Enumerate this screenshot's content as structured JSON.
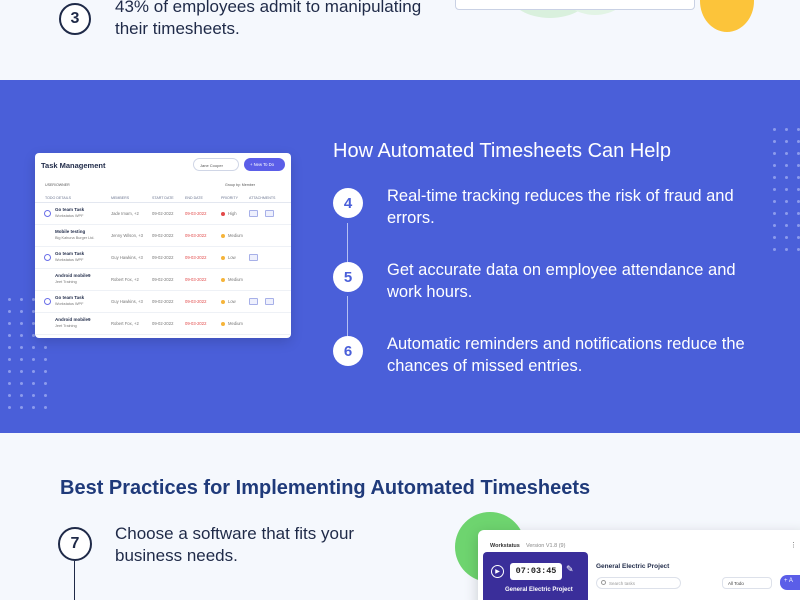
{
  "top": {
    "step_number": "3",
    "text": "43% of employees admit to manipulating their timesheets."
  },
  "blue": {
    "title": "How Automated Timesheets Can Help",
    "steps": [
      {
        "number": "4",
        "text": "Real-time tracking reduces the risk of fraud and errors."
      },
      {
        "number": "5",
        "text": "Get accurate data on employee attendance and work hours."
      },
      {
        "number": "6",
        "text": "Automatic reminders and notifications reduce the chances of missed entries."
      }
    ]
  },
  "task_card": {
    "title": "Task Management",
    "user_select": "Jane Cooper",
    "new_button": "+ New To Do",
    "subheading": "USER/OWNER",
    "group_by": "Group by: Member",
    "columns": [
      "TODO DETAILS",
      "MEMBERS",
      "START DATE",
      "END DATE",
      "PRIORITY",
      "ATTACHMENTS"
    ],
    "rows": [
      {
        "name": "Go team Task",
        "project": "Workstatus WPF",
        "members": "Jade Imam, +2",
        "start": "09-02-2022",
        "end": "09-03-2022",
        "priority": "High",
        "priority_color": "#e24a4a"
      },
      {
        "name": "Mobile testing",
        "project": "Big Kahuna Burger Ltd.",
        "members": "Jenny Wilson, +3",
        "start": "09-02-2022",
        "end": "09-03-2022",
        "priority": "Medium",
        "priority_color": "#f5b43a"
      },
      {
        "name": "Go team Task",
        "project": "Workstatus WPF",
        "members": "Guy Hawkins, +3",
        "start": "09-02-2022",
        "end": "09-03-2022",
        "priority": "Low",
        "priority_color": "#f5b43a"
      },
      {
        "name": "Android mobile9",
        "project": "Jeet Training",
        "members": "Robert Fox, +2",
        "start": "09-02-2022",
        "end": "09-03-2022",
        "priority": "Medium",
        "priority_color": "#f5b43a"
      },
      {
        "name": "Go team Task",
        "project": "Workstatus WPF",
        "members": "Guy Hawkins, +3",
        "start": "09-02-2022",
        "end": "09-03-2022",
        "priority": "Low",
        "priority_color": "#f5b43a"
      },
      {
        "name": "Android mobile9",
        "project": "Jeet Training",
        "members": "Robert Fox, +2",
        "start": "09-02-2022",
        "end": "09-03-2022",
        "priority": "Medium",
        "priority_color": "#f5b43a"
      }
    ]
  },
  "bottom": {
    "title": "Best Practices for Implementing Automated Timesheets",
    "step_number": "7",
    "text": "Choose a software that fits your business needs."
  },
  "ws_card": {
    "brand": "Workstatus",
    "version": "Version V1.8 (9)",
    "timer": "07:03:45",
    "side_project": "General Electric Project",
    "project_title": "General Electric Project",
    "search_placeholder": "Search tasks",
    "filter_select": "All Todo",
    "add_button": "+ A"
  },
  "colors": {
    "blue_bg": "#4a5fd9",
    "accent": "#5b5ee8",
    "yellow": "#fcc43a",
    "green": "#6ed46f",
    "due_red": "#e24a4a"
  }
}
